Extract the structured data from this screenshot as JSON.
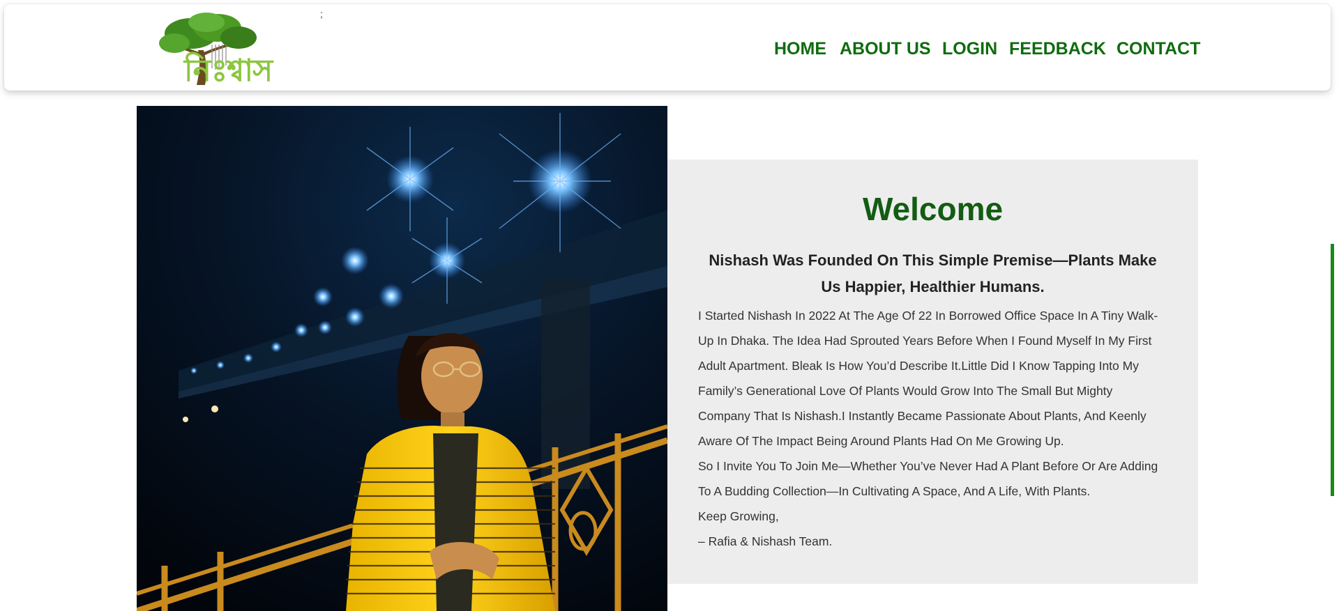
{
  "header": {
    "stray_mark": ";",
    "logo_text": "নিঃশ্বাস",
    "nav": [
      {
        "label": "HOME"
      },
      {
        "label": "ABOUT US"
      },
      {
        "label": "LOGIN"
      },
      {
        "label": "FEEDBACK"
      },
      {
        "label": "CONTACT"
      }
    ]
  },
  "colors": {
    "nav_green": "#0f6b0f",
    "heading_green": "#135c13",
    "panel_bg": "#ededed",
    "logo_green": "#8cc63f"
  },
  "about": {
    "title": "Welcome",
    "subtitle": "Nishash Was Founded On This Simple Premise—Plants Make Us Happier, Healthier Humans.",
    "paragraphs": [
      "I Started Nishash In 2022 At The Age Of 22 In Borrowed Office Space In A Tiny Walk-Up In Dhaka. The Idea Had Sprouted Years Before When I Found Myself In My First Adult Apartment. Bleak Is How You’d Describe It.Little Did I Know Tapping Into My Family’s Generational Love Of Plants Would Grow Into The Small But Mighty Company That Is Nishash.I Instantly Became Passionate About Plants, And Keenly Aware Of The Impact Being Around Plants Had On Me Growing Up.",
      "So I Invite You To Join Me—Whether You’ve Never Had A Plant Before Or Are Adding To A Budding Collection—In Cultivating A Space, And A Life, With Plants.",
      "Keep Growing,",
      "– Rafia & Nishash Team."
    ]
  }
}
